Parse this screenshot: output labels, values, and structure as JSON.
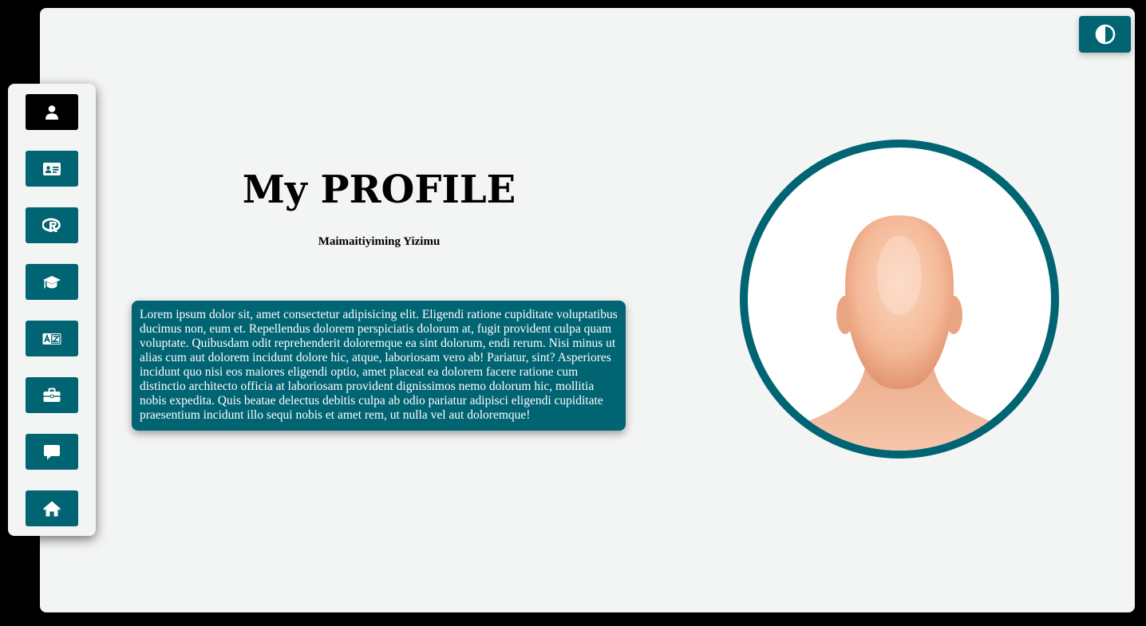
{
  "page": {
    "title": "My PROFILE",
    "name": "Maimaitiyiming Yizimu",
    "bio": "Lorem ipsum dolor sit, amet consectetur adipisicing elit. Eligendi ratione cupiditate voluptatibus ducimus non, eum et. Repellendus dolorem perspiciatis dolorum at, fugit provident culpa quam voluptate. Quibusdam odit reprehenderit doloremque ea sint dolorum, endi rerum. Nisi minus ut alias cum aut dolorem incidunt dolore hic, atque, laboriosam vero ab! Pariatur, sint? Asperiores incidunt quo nisi eos maiores eligendi optio, amet placeat ea dolorem facere ratione cum distinctio architecto officia at laboriosam provident dignissimos nemo dolorum hic, mollitia nobis expedita. Quis beatae delectus debitis culpa ab odio pariatur adipisci eligendi cupiditate praesentium incidunt illo sequi nobis et amet rem, ut nulla vel aut doloremque!"
  },
  "sidebar": {
    "items": [
      {
        "icon": "user-icon",
        "active": true
      },
      {
        "icon": "id-card-icon",
        "active": false
      },
      {
        "icon": "r-language-icon",
        "active": false
      },
      {
        "icon": "graduation-cap-icon",
        "active": false
      },
      {
        "icon": "language-icon",
        "active": false
      },
      {
        "icon": "briefcase-icon",
        "active": false
      },
      {
        "icon": "message-icon",
        "active": false
      },
      {
        "icon": "home-icon",
        "active": false
      }
    ]
  },
  "theme_toggle": {
    "icon": "contrast-icon"
  },
  "avatar": {
    "icon": "faceless-head-avatar"
  },
  "colors": {
    "accent": "#006473",
    "active": "#000000",
    "background": "#f3f4f4",
    "outer": "#000000"
  }
}
